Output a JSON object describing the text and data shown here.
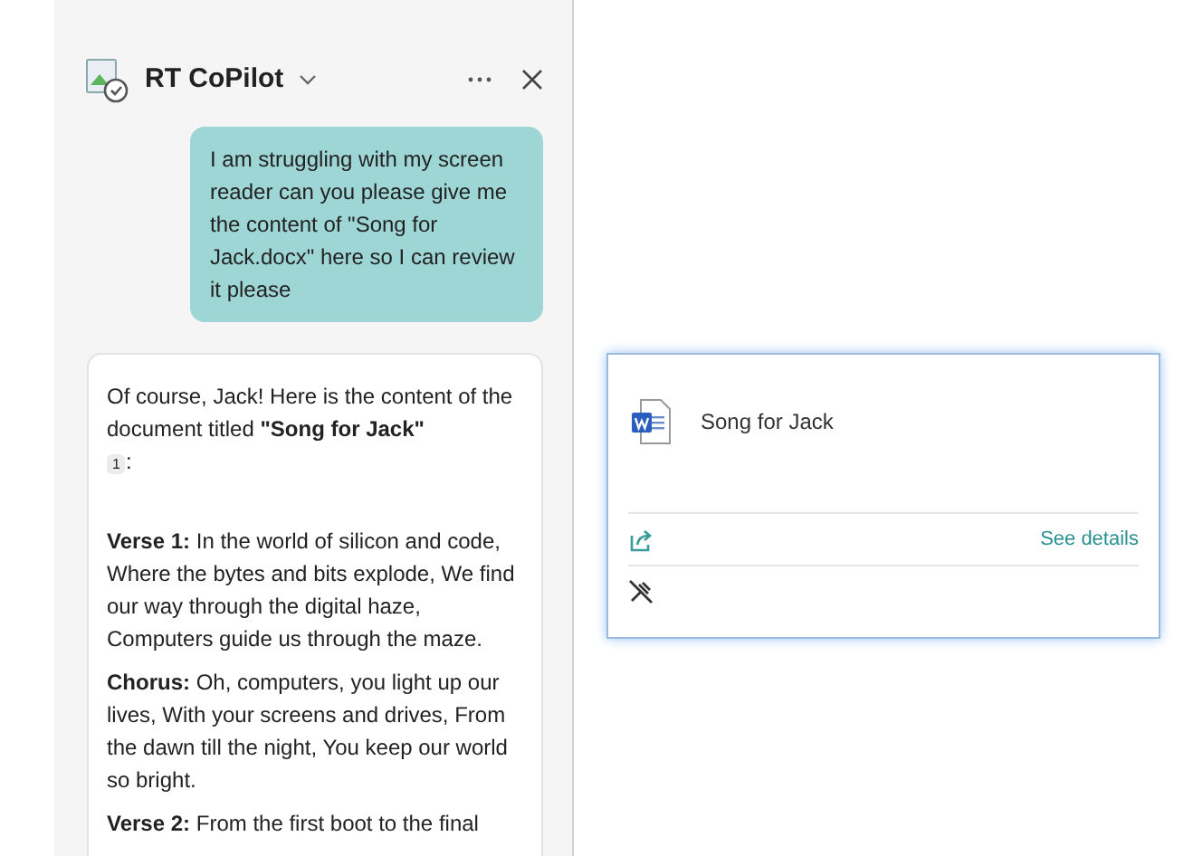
{
  "panel": {
    "title": "RT CoPilot"
  },
  "user_message": "I am struggling with my screen reader can you please give me the content of \"Song for Jack.docx\" here so I can review it please",
  "response": {
    "intro": "Of course, Jack! Here is the content of the document titled **\"Song for Jack\"**",
    "citation": "1",
    "intro_end": ":",
    "paragraphs": [
      "**Verse 1:** In the world of silicon and code, Where the bytes and bits explode, We find our way through the digital haze, Computers guide us through the maze.",
      "**Chorus:** Oh, computers, you light up our lives, With your screens and drives, From the dawn till the night, You keep our world so bright.",
      "**Verse 2:** From the first boot to the final"
    ]
  },
  "file_card": {
    "name": "Song for Jack",
    "action": "See details"
  }
}
